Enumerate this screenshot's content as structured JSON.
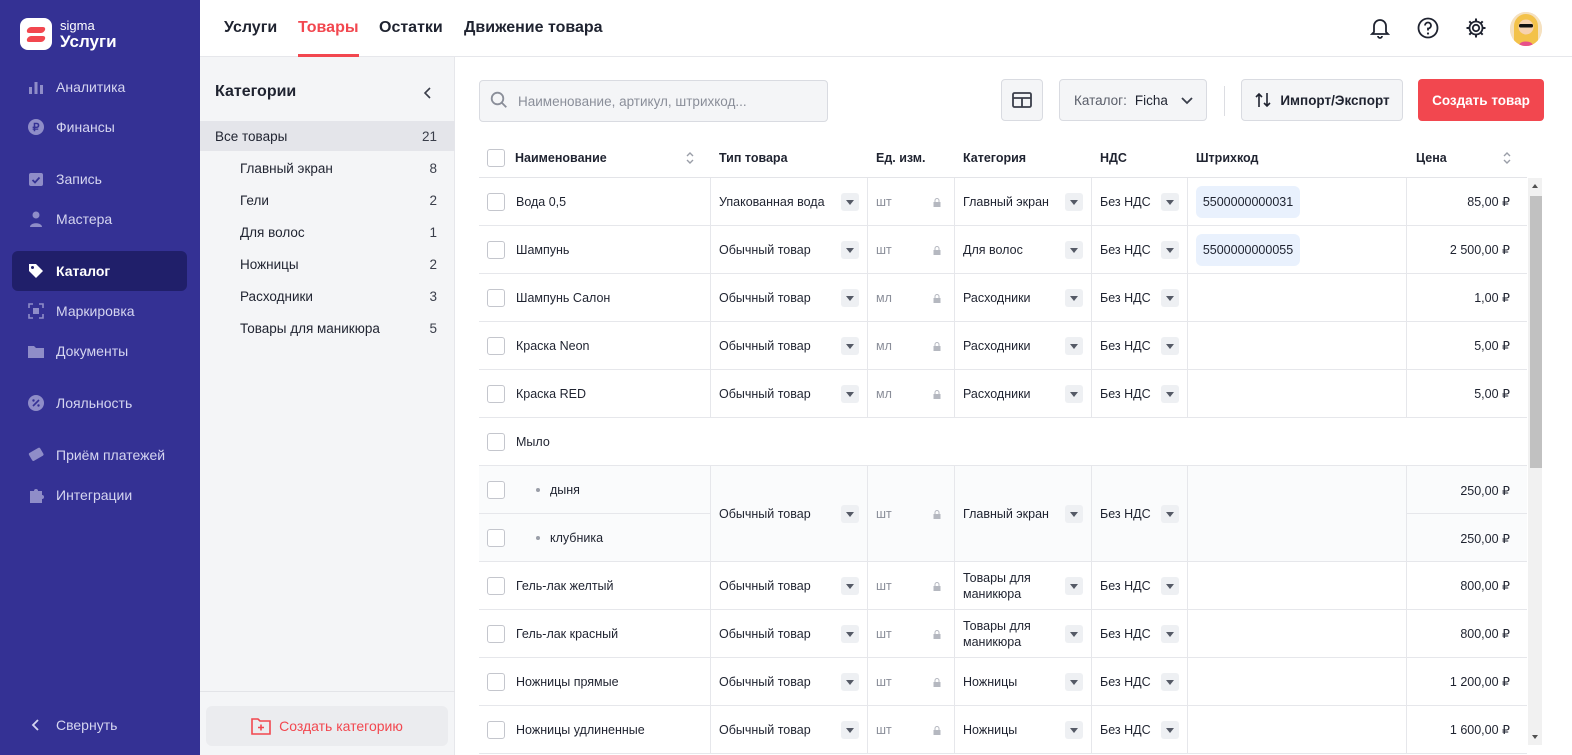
{
  "app": {
    "brand_small": "sigma",
    "brand_big": "Услуги"
  },
  "sidebar": {
    "items": [
      {
        "label": "Аналитика",
        "icon": "chart-icon"
      },
      {
        "label": "Финансы",
        "icon": "ruble-icon"
      },
      {
        "label": "Запись",
        "icon": "calendar-icon"
      },
      {
        "label": "Мастера",
        "icon": "master-icon"
      },
      {
        "label": "Каталог",
        "icon": "tag-icon"
      },
      {
        "label": "Маркировка",
        "icon": "scan-icon"
      },
      {
        "label": "Документы",
        "icon": "folder-icon"
      },
      {
        "label": "Лояльность",
        "icon": "percent-badge-icon"
      },
      {
        "label": "Приём платежей",
        "icon": "payment-icon"
      },
      {
        "label": "Интеграции",
        "icon": "puzzle-icon"
      }
    ],
    "active": "Каталог",
    "collapse_label": "Свернуть"
  },
  "top_tabs": [
    "Услуги",
    "Товары",
    "Остатки",
    "Движение товара"
  ],
  "active_tab": "Товары",
  "categories": {
    "title": "Категории",
    "items": [
      {
        "label": "Все товары",
        "count": "21"
      },
      {
        "label": "Главный экран",
        "count": "8"
      },
      {
        "label": "Гели",
        "count": "2"
      },
      {
        "label": "Для волос",
        "count": "1"
      },
      {
        "label": "Ножницы",
        "count": "2"
      },
      {
        "label": "Расходники",
        "count": "3"
      },
      {
        "label": "Товары для маникюра",
        "count": "5"
      }
    ],
    "create_label": "Создать категорию"
  },
  "toolbar": {
    "search_placeholder": "Наименование, артикул, штрихкод...",
    "catalog_label": "Каталог:",
    "catalog_value": "Ficha",
    "import_export_label": "Импорт/Экспорт",
    "create_label": "Создать товар"
  },
  "table": {
    "headers": {
      "name": "Наименование",
      "type": "Тип товара",
      "unit": "Ед. изм.",
      "category": "Категория",
      "vat": "НДС",
      "barcode": "Штрихкод",
      "price": "Цена"
    },
    "rows": [
      {
        "name": "Вода 0,5",
        "type": "Упакованная вода",
        "unit": "шт",
        "category": "Главный экран",
        "vat": "Без НДС",
        "barcode": "5500000000031",
        "price": "85,00 ₽"
      },
      {
        "name": "Шампунь",
        "type": "Обычный товар",
        "unit": "шт",
        "category": "Для волос",
        "vat": "Без НДС",
        "barcode": "5500000000055",
        "price": "2 500,00 ₽"
      },
      {
        "name": "Шампунь Салон",
        "type": "Обычный товар",
        "unit": "мл",
        "category": "Расходники",
        "vat": "Без НДС",
        "barcode": "",
        "price": "1,00 ₽"
      },
      {
        "name": "Краска Neon",
        "type": "Обычный товар",
        "unit": "мл",
        "category": "Расходники",
        "vat": "Без НДС",
        "barcode": "",
        "price": "5,00 ₽"
      },
      {
        "name": "Краска RED",
        "type": "Обычный товар",
        "unit": "мл",
        "category": "Расходники",
        "vat": "Без НДС",
        "barcode": "",
        "price": "5,00 ₽"
      }
    ],
    "group": {
      "name": "Мыло",
      "variants": [
        {
          "name": "дыня",
          "price": "250,00 ₽"
        },
        {
          "name": "клубника",
          "price": "250,00 ₽"
        }
      ],
      "type": "Обычный товар",
      "unit": "шт",
      "category": "Главный экран",
      "vat": "Без НДС"
    },
    "rows2": [
      {
        "name": "Гель-лак желтый",
        "type": "Обычный товар",
        "unit": "шт",
        "category_line1": "Товары для",
        "category_line2": "маникюра",
        "vat": "Без НДС",
        "price": "800,00 ₽"
      },
      {
        "name": "Гель-лак красный",
        "type": "Обычный товар",
        "unit": "шт",
        "category_line1": "Товары для",
        "category_line2": "маникюра",
        "vat": "Без НДС",
        "price": "800,00 ₽"
      },
      {
        "name": "Ножницы прямые",
        "type": "Обычный товар",
        "unit": "шт",
        "category_line1": "Ножницы",
        "category_line2": "",
        "vat": "Без НДС",
        "price": "1 200,00 ₽"
      },
      {
        "name": "Ножницы удлиненные",
        "type": "Обычный товар",
        "unit": "шт",
        "category_line1": "Ножницы",
        "category_line2": "",
        "vat": "Без НДС",
        "price": "1 600,00 ₽"
      }
    ]
  },
  "colors": {
    "sidebar": "#343194",
    "sidebar_active": "#201f6a",
    "accent": "#f2474f",
    "barcode_bg": "#e9f1fd"
  }
}
